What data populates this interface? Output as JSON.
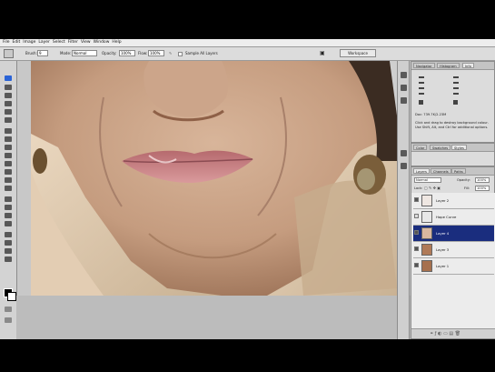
{
  "menu": {
    "items": [
      "File",
      "Edit",
      "Image",
      "Layer",
      "Select",
      "Filter",
      "View",
      "Window",
      "Help"
    ]
  },
  "options_bar": {
    "brush_label": "Brush:",
    "brush_size": "9",
    "mode_label": "Mode:",
    "mode_value": "Normal",
    "opacity_label": "Opacity:",
    "opacity_value": "100%",
    "flow_label": "Flow:",
    "flow_value": "100%",
    "sample_label": "Sample All Layers",
    "workspace_label": "Workspace"
  },
  "info_panel": {
    "tabs": [
      "Navigator",
      "Histogram",
      "Info"
    ],
    "doc_line": "Doc: 739.7K/2.23M",
    "hint": "Click and drag to destroy background colour. Use Shift, Alt, and Ctrl for additional options."
  },
  "color_panel": {
    "tabs": [
      "Color",
      "Swatches",
      "Styles"
    ]
  },
  "layers_panel": {
    "tabs": [
      "Layers",
      "Channels",
      "Paths"
    ],
    "blend_mode": "Normal",
    "opacity_label": "Opacity:",
    "opacity_value": "100%",
    "lock_label": "Lock:",
    "fill_label": "Fill:",
    "fill_value": "100%",
    "layers": [
      {
        "name": "Layer 2",
        "visible": true,
        "selected": false,
        "thumb": "#efe7e2"
      },
      {
        "name": "Hope Curve",
        "visible": false,
        "selected": false,
        "thumb": "#e8e8e8"
      },
      {
        "name": "Layer 4",
        "visible": true,
        "selected": true,
        "thumb": "#d8b8a0"
      },
      {
        "name": "Layer 3",
        "visible": true,
        "selected": false,
        "thumb": "#b07a58"
      },
      {
        "name": "Layer 1",
        "visible": true,
        "selected": false,
        "thumb": "#a6704e"
      }
    ]
  },
  "colors": {
    "accent_selected": "#1a2d7e",
    "active_tool": "#2a63d6",
    "chrome": "#dcdcdc"
  }
}
